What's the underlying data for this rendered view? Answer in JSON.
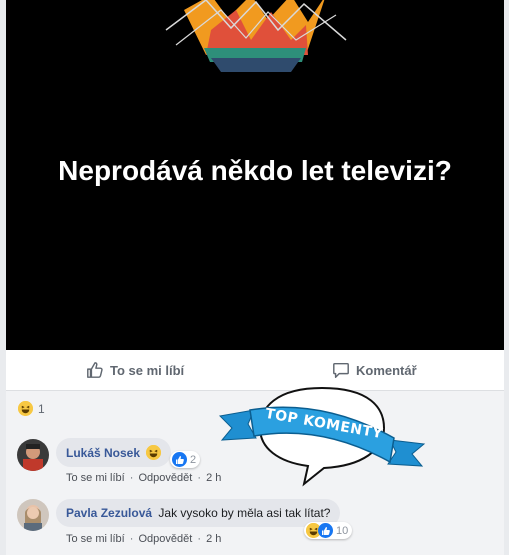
{
  "post": {
    "text": "Neprodává někdo let televizi?"
  },
  "actions": {
    "like_label": "To se mi líbí",
    "comment_label": "Komentář"
  },
  "reactions_summary": {
    "icon": "haha-icon",
    "count": "1"
  },
  "top_badge": {
    "text": "TOP KOMENTY",
    "color": "#1f8fd1"
  },
  "comments": [
    {
      "author": "Lukáš Nosek",
      "text": "",
      "emoji": "haha-icon",
      "reaction_count": "2",
      "like": "To se mi líbí",
      "reply": "Odpovědět",
      "time": "2 h",
      "sep": "·"
    },
    {
      "author": "Pavla Zezulová",
      "text": "Jak vysoko by měla asi tak lítat?",
      "reaction_count": "10",
      "like": "To se mi líbí",
      "reply": "Odpovědět",
      "time": "2 h",
      "sep": "·"
    }
  ]
}
